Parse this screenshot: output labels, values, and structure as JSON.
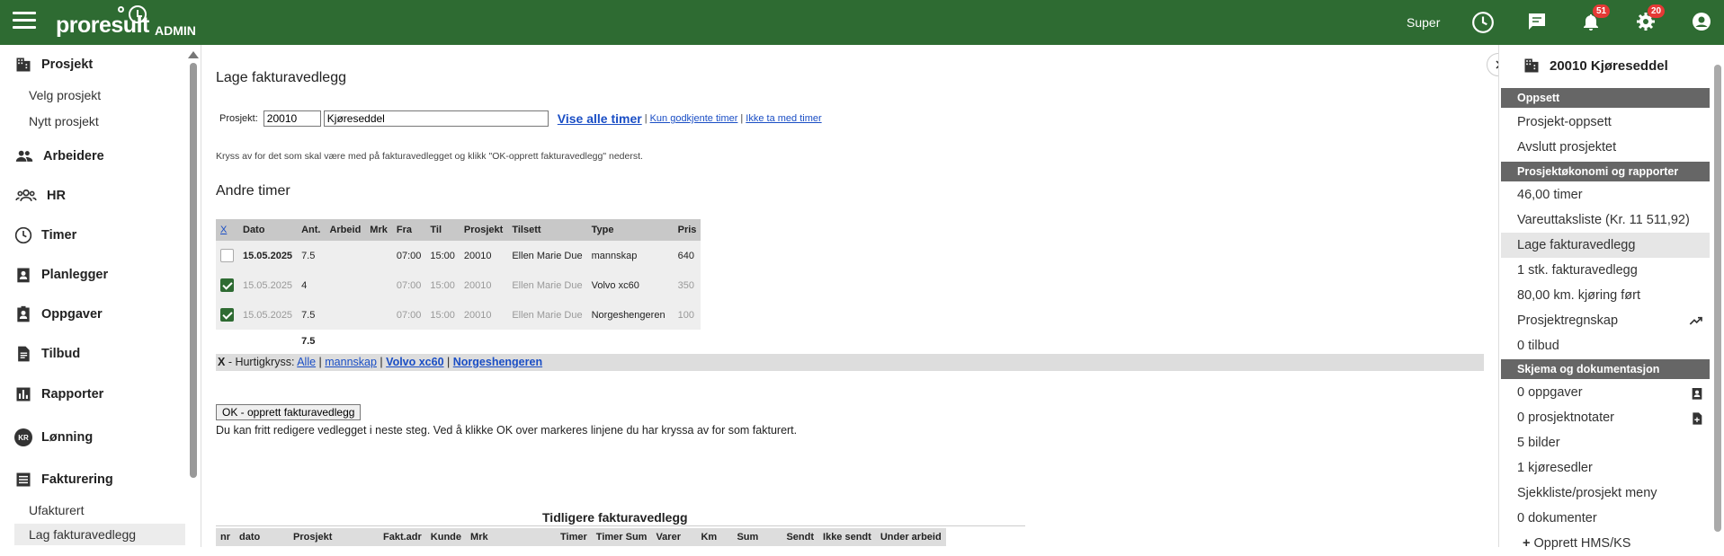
{
  "header": {
    "logo_text": "proresult",
    "admin_label": "ADMIN",
    "user_name": "Super",
    "notifications_count": "51",
    "alerts_count": "20"
  },
  "sidebar": {
    "items": [
      {
        "label": "Prosjekt"
      },
      {
        "label": "Arbeidere"
      },
      {
        "label": "HR"
      },
      {
        "label": "Timer"
      },
      {
        "label": "Planlegger"
      },
      {
        "label": "Oppgaver"
      },
      {
        "label": "Tilbud"
      },
      {
        "label": "Rapporter"
      },
      {
        "label": "Lønning",
        "avatar": "KR"
      },
      {
        "label": "Fakturering"
      }
    ],
    "prosjekt_sub": [
      "Velg prosjekt",
      "Nytt prosjekt"
    ],
    "fakt_sub": [
      "Ufakturert",
      "Lag fakturavedlegg"
    ]
  },
  "main": {
    "title": "Lage fakturavedlegg",
    "project_label": "Prosjekt:",
    "project_number": "20010",
    "project_name": "Kjøreseddel",
    "link_all": "Vise alle timer",
    "link_approved": "Kun godkjente timer",
    "link_exclude": "Ikke ta med timer",
    "hint": "Kryss av for det som skal være med på fakturavedlegget og klikk \"OK-opprett fakturavedlegg\" nederst.",
    "section_title": "Andre timer",
    "table": {
      "headers": [
        "X",
        "Dato",
        "Ant.",
        "Arbeid",
        "Mrk",
        "Fra",
        "Til",
        "Prosjekt",
        "Tilsett",
        "Type",
        "Pris"
      ],
      "rows": [
        {
          "checked": false,
          "dato": "15.05.2025",
          "ant": "7.5",
          "arbeid": "",
          "mrk": "",
          "fra": "07:00",
          "til": "15:00",
          "prosjekt": "20010",
          "tilsett": "Ellen Marie Due",
          "type": "mannskap",
          "pris": "640"
        },
        {
          "checked": true,
          "dato": "15.05.2025",
          "ant": "4",
          "arbeid": "",
          "mrk": "",
          "fra": "07:00",
          "til": "15:00",
          "prosjekt": "20010",
          "tilsett": "Ellen Marie Due",
          "type": "Volvo xc60",
          "pris": "350"
        },
        {
          "checked": true,
          "dato": "15.05.2025",
          "ant": "7.5",
          "arbeid": "",
          "mrk": "",
          "fra": "07:00",
          "til": "15:00",
          "prosjekt": "20010",
          "tilsett": "Ellen Marie Due",
          "type": "Norgeshengeren",
          "pris": "100"
        }
      ],
      "sum": "7.5"
    },
    "quick": {
      "prefix": "X",
      "label": " - Hurtigkryss: ",
      "links": [
        "Alle",
        "mannskap",
        "Volvo xc60",
        "Norgeshengeren"
      ]
    },
    "ok_button": "OK - opprett fakturavedlegg",
    "ok_text": "Du kan fritt redigere vedlegget i neste steg. Ved å klikke OK over markeres linjene du har kryssa av for som fakturert.",
    "previous_title": "Tidligere fakturavedlegg",
    "previous_headers": [
      "nr",
      "dato",
      "Prosjekt",
      "Fakt.adr",
      "Kunde",
      "Mrk",
      "Timer",
      "Timer Sum",
      "Varer",
      "Km",
      "Sum",
      "Sendt",
      "Ikke sendt",
      "Under arbeid"
    ]
  },
  "rpanel": {
    "title": "20010 Kjøreseddel",
    "sections": {
      "oppsett": "Oppsett",
      "okonomi": "Prosjektøkonomi og rapporter",
      "skjema": "Skjema og dokumentasjon"
    },
    "oppsett_items": [
      "Prosjekt-oppsett",
      "Avslutt prosjektet"
    ],
    "okonomi_items": [
      "46,00 timer",
      "Vareuttaksliste (Kr. 11 511,92)",
      "Lage fakturavedlegg",
      "1 stk. fakturavedlegg",
      "80,00 km. kjøring ført",
      "Prosjektregnskap",
      "0 tilbud"
    ],
    "skjema_items": [
      "0 oppgaver",
      "0 prosjektnotater",
      "5 bilder",
      "1 kjøresedler",
      "Sjekkliste/prosjekt meny",
      "0 dokumenter",
      "Opprett HMS/KS"
    ]
  }
}
